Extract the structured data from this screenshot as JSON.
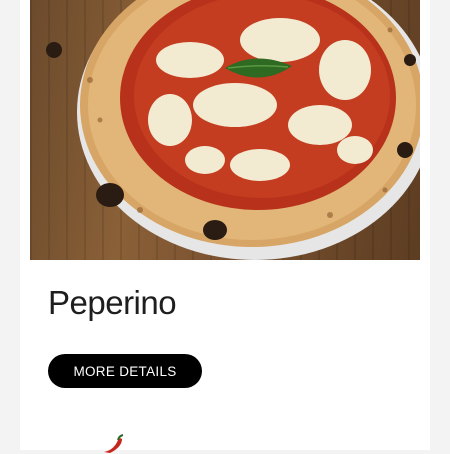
{
  "product": {
    "name": "Peperino",
    "image_alt": "Neapolitan pizza with tomato sauce, mozzarella and basil",
    "details_button_label": "MORE DETAILS",
    "spice_icon": "chili-pepper-icon"
  },
  "colors": {
    "button_bg": "#000000",
    "button_text": "#ffffff",
    "title_text": "#1e1e1e",
    "page_bg": "#f3f3f3",
    "card_bg": "#ffffff",
    "chili": "#c8261d"
  }
}
